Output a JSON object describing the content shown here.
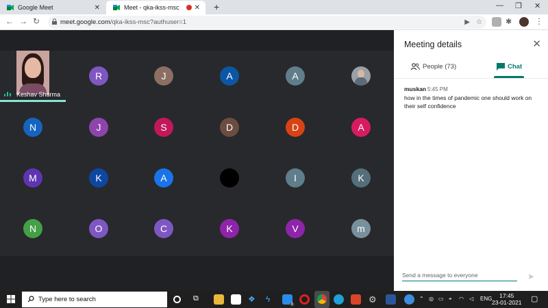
{
  "browser": {
    "tabs": [
      {
        "label": "Google Meet"
      },
      {
        "label": "Meet - qka-ikss-msc"
      }
    ],
    "url_main": "meet.google.com",
    "url_path": "/qka-ikss-msc?authuser=1"
  },
  "meeting": {
    "self_name": "Keshav Sharma",
    "participants_grid": [
      {
        "initial": "R",
        "color": "#7e57c2"
      },
      {
        "initial": "J",
        "color": "#8d6e63"
      },
      {
        "initial": "A",
        "color": "#0b57a5"
      },
      {
        "initial": "A",
        "color": "#607d8b"
      },
      {
        "initial": "",
        "photo": true
      },
      {
        "initial": "N",
        "color": "#1565c0"
      },
      {
        "initial": "J",
        "color": "#8e44ad"
      },
      {
        "initial": "S",
        "color": "#c2185b"
      },
      {
        "initial": "D",
        "color": "#6d4c41"
      },
      {
        "initial": "D",
        "color": "#d84315"
      },
      {
        "initial": "A",
        "color": "#d81b60"
      },
      {
        "initial": "M",
        "color": "#5e35b1"
      },
      {
        "initial": "K",
        "color": "#0d47a1"
      },
      {
        "initial": "A",
        "color": "#1a73e8"
      },
      {
        "initial": "",
        "color": "#000000"
      },
      {
        "initial": "I",
        "color": "#607d8b"
      },
      {
        "initial": "K",
        "color": "#546e7a"
      },
      {
        "initial": "N",
        "color": "#43a047"
      },
      {
        "initial": "O",
        "color": "#7e57c2"
      },
      {
        "initial": "C",
        "color": "#7e57c2"
      },
      {
        "initial": "K",
        "color": "#8e24aa"
      },
      {
        "initial": "V",
        "color": "#8e24aa"
      },
      {
        "initial": "m",
        "color": "#78909c"
      }
    ]
  },
  "panel": {
    "title": "Meeting details",
    "people_tab": "People (73)",
    "chat_tab": "Chat",
    "messages": [
      {
        "sender": "muskan",
        "time": "5:45 PM",
        "text": "how in the times of pandemic one should work on their self confidence"
      }
    ],
    "composer_placeholder": "Send a message to everyone"
  },
  "taskbar": {
    "search_placeholder": "Type here to search",
    "language": "ENG",
    "time": "17:45",
    "date": "23-01-2021",
    "mail_badge": "8"
  },
  "colors": {
    "accent": "#00796b",
    "meet_bg": "#202124",
    "name_bar": "#88e7d6"
  }
}
